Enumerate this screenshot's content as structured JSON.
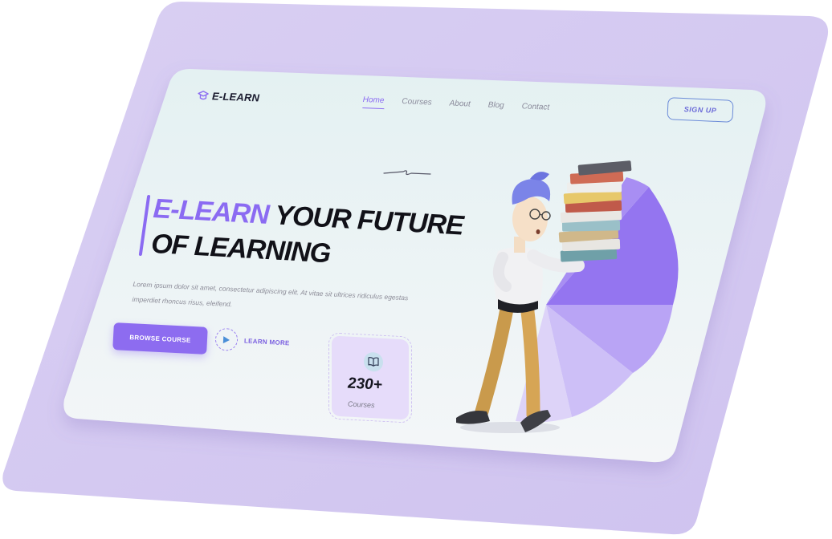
{
  "brand": {
    "name": "E-LEARN",
    "logo_icon": "graduation-cap-icon"
  },
  "nav": {
    "links": [
      {
        "label": "Home",
        "active": true
      },
      {
        "label": "Courses",
        "active": false
      },
      {
        "label": "About",
        "active": false
      },
      {
        "label": "Blog",
        "active": false
      },
      {
        "label": "Contact",
        "active": false
      }
    ],
    "signup_label": "SIGN UP"
  },
  "hero": {
    "title_accent": "E-LEARN",
    "title_line1_rest": " YOUR FUTURE",
    "title_line2": "OF LEARNING",
    "description": "Lorem ipsum dolor sit amet, consectetur adipiscing elit. At vitae sit ultrices ridiculus egestas imperdiet rhoncus risus, eleifend.",
    "browse_label": "BROWSE COURSE",
    "learn_more_label": "LEARN MORE"
  },
  "stats": {
    "count": "230+",
    "label": "Courses",
    "icon": "book-icon"
  },
  "colors": {
    "accent": "#8b6bf2",
    "backdrop": "#d8cdf2",
    "card_bg": "#eef4f5",
    "dark_text": "#111118"
  }
}
